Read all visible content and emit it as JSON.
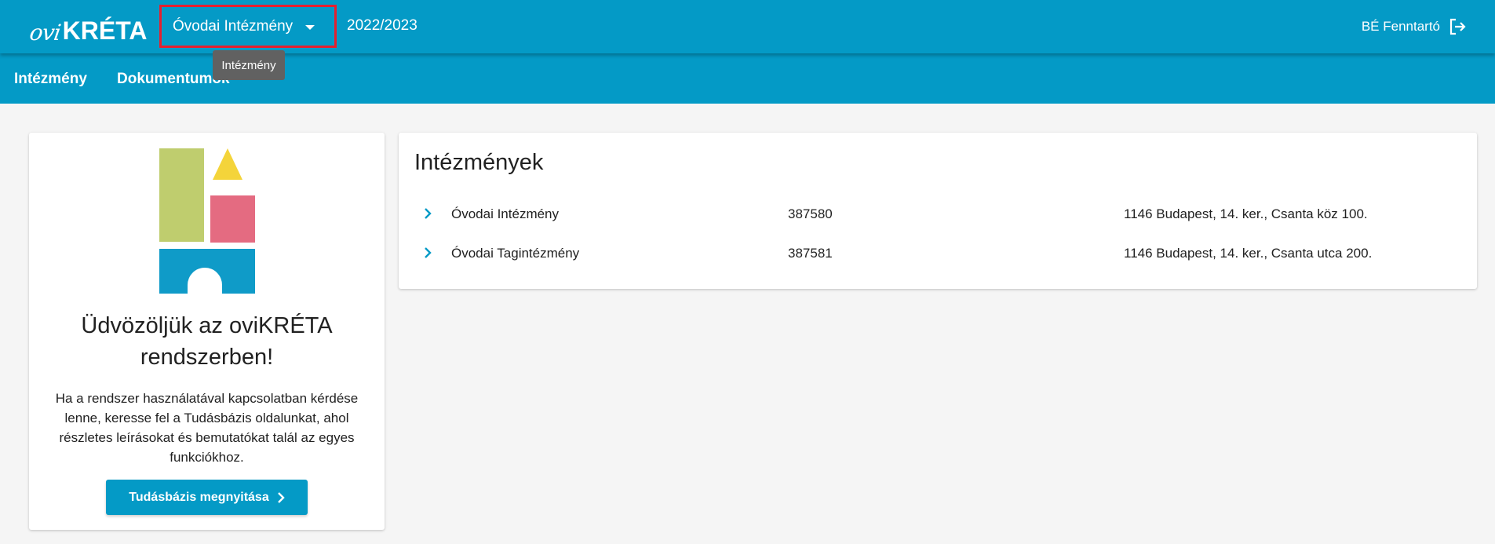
{
  "header": {
    "logo": {
      "ovi": "ovi",
      "kreta": "KRÉTA"
    },
    "institution_select": {
      "value": "Óvodai Intézmény",
      "icon": "caret-down-icon"
    },
    "school_year": "2022/2023",
    "user": {
      "name": "BÉ Fenntartó",
      "icon": "logout-icon"
    },
    "tooltip": "Intézmény"
  },
  "nav": {
    "items": [
      {
        "label": "Intézmény"
      },
      {
        "label": "Dokumentumok"
      }
    ]
  },
  "welcome": {
    "title": "Üdvözöljük az oviKRÉTA rendszerben!",
    "text": "Ha a rendszer használatával kapcsolatban kérdése lenne, keresse fel a Tudásbázis oldalunkat, ahol részletes leírásokat és bemutatókat talál az egyes funkciókhoz.",
    "button": "Tudásbázis megnyitása",
    "colors": {
      "green": "#bfcd6e",
      "yellow": "#f4d43a",
      "pink": "#e46b81",
      "blue": "#0f9bc8"
    }
  },
  "institutions": {
    "title": "Intézmények",
    "rows": [
      {
        "name": "Óvodai Intézmény",
        "code": "387580",
        "address": "1146 Budapest, 14. ker., Csanta köz 100."
      },
      {
        "name": "Óvodai Tagintézmény",
        "code": "387581",
        "address": "1146 Budapest, 14. ker., Csanta utca 200."
      }
    ]
  },
  "colors": {
    "brand": "#049ac6",
    "highlight": "#e5202e",
    "tooltip": "#616161"
  }
}
